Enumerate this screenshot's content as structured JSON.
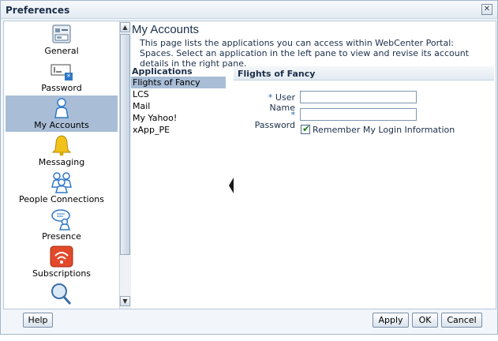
{
  "dialog": {
    "title": "Preferences",
    "close_glyph": "✕"
  },
  "nav": {
    "items": [
      {
        "label": "General",
        "icon": "general-icon",
        "selected": false
      },
      {
        "label": "Password",
        "icon": "password-icon",
        "selected": false
      },
      {
        "label": "My Accounts",
        "icon": "user-icon",
        "selected": true
      },
      {
        "label": "Messaging",
        "icon": "bell-icon",
        "selected": false
      },
      {
        "label": "People Connections",
        "icon": "people-icon",
        "selected": false
      },
      {
        "label": "Presence",
        "icon": "presence-icon",
        "selected": false
      },
      {
        "label": "Subscriptions",
        "icon": "subscriptions-icon",
        "selected": false
      },
      {
        "label": "",
        "icon": "search-icon",
        "selected": false
      }
    ]
  },
  "scroll": {
    "up": "▲",
    "down": "▼"
  },
  "main": {
    "title": "My Accounts",
    "description": "This page lists the applications you can access within WebCenter Portal: Spaces. Select an application in the left pane to view and revise its account details in the right pane."
  },
  "applications": {
    "header": "Applications",
    "items": [
      "Flights of Fancy",
      "LCS",
      "Mail",
      "My Yahoo!",
      "xApp_PE"
    ],
    "selected_index": 0
  },
  "detail": {
    "title": "Flights of Fancy",
    "required_marker": "*",
    "user_name_label": "User Name",
    "user_name_value": "",
    "password_label": "Password",
    "password_value": "",
    "remember_label": "Remember My Login Information",
    "remember_checked": true,
    "check_glyph": "✔"
  },
  "buttons": {
    "help": "Help",
    "apply": "Apply",
    "ok": "OK",
    "cancel": "Cancel"
  },
  "colors": {
    "selection": "#a9bdd6",
    "accent": "#1c2f4a"
  }
}
